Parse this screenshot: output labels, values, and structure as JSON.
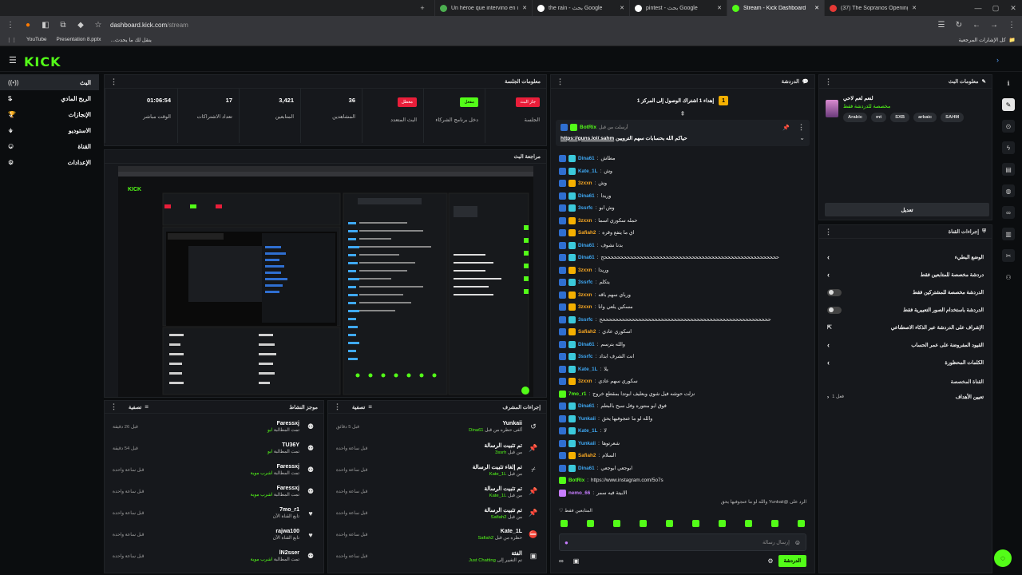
{
  "browser": {
    "tabs": [
      {
        "title": "(37) The Sopranos Opening Cre",
        "color": "#e53935",
        "active": false
      },
      {
        "title": "Stream - Kick Dashboard",
        "color": "#53fc18",
        "active": true
      },
      {
        "title": "pintest - بحث Google",
        "color": "#ffffff",
        "active": false
      },
      {
        "title": "the rain - بحث Google",
        "color": "#ffffff",
        "active": false
      },
      {
        "title": "Un héroe que intervino en un a",
        "color": "#4caf50",
        "active": false
      }
    ],
    "url_host": "dashboard.kick.com",
    "url_path": "/stream",
    "bookmarks": [
      "كل الإشارات المرجعية",
      "YouTube",
      "Presentation 8.pptx",
      "ينقل لك ما يحدث..."
    ]
  },
  "brand": {
    "logo": "KICK"
  },
  "sidebar": {
    "items": [
      {
        "label": "البث",
        "icon": "live-icon",
        "active": true
      },
      {
        "label": "الربح المادي",
        "icon": "dollar-icon",
        "active": false
      },
      {
        "label": "الإنجازات",
        "icon": "trophy-icon",
        "active": false
      },
      {
        "label": "الاستوديو",
        "icon": "studio-icon",
        "active": false
      },
      {
        "label": "القناة",
        "icon": "channel-icon",
        "active": false
      },
      {
        "label": "الإعدادات",
        "icon": "gear-icon",
        "active": false
      }
    ]
  },
  "session": {
    "title": "معلومات الجلسة",
    "stats": [
      {
        "value": "جار البث",
        "label": "الجلسة",
        "badge_color": "#e91e3a"
      },
      {
        "value": "مفعل",
        "label": "دخل برنامج الشركاء",
        "badge_color": "#53fc18"
      },
      {
        "value": "معطل",
        "label": "البث المتعدد",
        "badge_color": "#e91e3a"
      },
      {
        "value": "36",
        "label": "المشاهدين"
      },
      {
        "value": "3,421",
        "label": "المتابعين"
      },
      {
        "value": "17",
        "label": "تعداد الاشتراكات"
      },
      {
        "value": "01:06:54",
        "label": "الوقت مباشر"
      }
    ]
  },
  "preview": {
    "title": "مراجعة البث"
  },
  "activity": {
    "title": "موجز النشاط",
    "filter": "تصفية",
    "items": [
      {
        "name": "Faressxj",
        "sub": "تمت المطالبة",
        "reward": "ابو",
        "time": "قبل 26 دقيقة"
      },
      {
        "name": "TU36Y",
        "sub": "تمت المطالبة",
        "reward": "ابو",
        "time": "قبل 54 دقيقة"
      },
      {
        "name": "Faressxj",
        "sub": "تمت المطالبة",
        "reward": "اشرب موية",
        "time": "قبل ساعة واحدة"
      },
      {
        "name": "Faressxj",
        "sub": "تمت المطالبة",
        "reward": "اشرب موية",
        "time": "قبل ساعة واحدة"
      },
      {
        "name": "7mo_r1",
        "sub": "تابع القناة الآن",
        "reward": "",
        "time": "قبل ساعة واحدة"
      },
      {
        "name": "rajwa100",
        "sub": "تابع القناة الآن",
        "reward": "",
        "time": "قبل ساعة واحدة"
      },
      {
        "name": "lN2sser",
        "sub": "تمت المطالبة",
        "reward": "اشرب موية",
        "time": "قبل ساعة واحدة"
      }
    ]
  },
  "modactions": {
    "title": "إجراءات المشرف",
    "filter": "تصفية",
    "items": [
      {
        "name": "Yunkaii",
        "sub": "ألغى حظره من قبل",
        "by": "Dina61",
        "time": "قبل 5 دقائق"
      },
      {
        "name": "تم تثبيت الرسالة",
        "sub": "من قبل",
        "by": "3ssrh",
        "time": "قبل ساعة واحدة"
      },
      {
        "name": "تم إلغاء تثبيت الرسالة",
        "sub": "من قبل",
        "by": "Kate_1L",
        "time": "قبل ساعة واحدة"
      },
      {
        "name": "تم تثبيت الرسالة",
        "sub": "من قبل",
        "by": "Kate_1L",
        "time": "قبل ساعة واحدة"
      },
      {
        "name": "تم تثبيت الرسالة",
        "sub": "من قبل",
        "by": "Safiah2",
        "time": "قبل ساعة واحدة"
      },
      {
        "name": "Kate_1L",
        "sub": "حظره من قبل",
        "by": "Safiah2",
        "time": "قبل ساعة واحدة"
      },
      {
        "name": "الفئة",
        "sub": "تم التغيير إلى",
        "by": "Just Chatting",
        "time": "قبل ساعة واحدة"
      }
    ]
  },
  "chat": {
    "title": "الدردشة",
    "goal": "إهداء 1 اشتراك الوصول إلى المركز 1",
    "goal_rank": "1",
    "pinned_by": "أرسلت من قبل",
    "pinned_user": "BotRix",
    "pinned_text": "حياكم الله بحسابات سهم الترويين",
    "pinned_link": "https://guns.lol/.sahm",
    "messages": [
      {
        "user": "Dina61",
        "color": "#3fa9f5",
        "text": "مطاش"
      },
      {
        "user": "Kate_1L",
        "color": "#3fa9f5",
        "text": "وش"
      },
      {
        "user": "3zxxn",
        "color": "#f5a623",
        "text": "وش"
      },
      {
        "user": "Dina61",
        "color": "#3fa9f5",
        "text": "وريدا"
      },
      {
        "user": "3ssrfc",
        "color": "#3fa9f5",
        "text": "وش ابو"
      },
      {
        "user": "3zxxn",
        "color": "#f5a623",
        "text": "حمله سكوري اسما"
      },
      {
        "user": "Safiah2",
        "color": "#f5a623",
        "text": "اي ما يتفع وقره"
      },
      {
        "user": "Dina61",
        "color": "#3fa9f5",
        "text": "بدنا نشوف"
      },
      {
        "user": "Dina61",
        "color": "#3fa9f5",
        "text": "ححححححححححححححححححححححححححححححححححححححححححححححححححححححح"
      },
      {
        "user": "3zxxn",
        "color": "#f5a623",
        "text": "وريدا"
      },
      {
        "user": "3ssrfc",
        "color": "#3fa9f5",
        "text": "يتكلم"
      },
      {
        "user": "3zxxn",
        "color": "#f5a623",
        "text": "ورباي سهم باقه"
      },
      {
        "user": "3zxxn",
        "color": "#f5a623",
        "text": "مسكين يلعي وانا"
      },
      {
        "user": "3ssrfc",
        "color": "#3fa9f5",
        "text": "ححححححححححححححححححححححححححححححححححححححححححححححححححححح"
      },
      {
        "user": "Safiah2",
        "color": "#f5a623",
        "text": "اسكوري عادي"
      },
      {
        "user": "Dina61",
        "color": "#3fa9f5",
        "text": "والله بترسم"
      },
      {
        "user": "3ssrfc",
        "color": "#3fa9f5",
        "text": "انت الشرف ابداد"
      },
      {
        "user": "Kate_1L",
        "color": "#3fa9f5",
        "text": "يلا"
      },
      {
        "user": "3zxxn",
        "color": "#f5a623",
        "text": "سكوري سهم عادي"
      },
      {
        "user": "7mo_r1",
        "color": "#53fc18",
        "text": "نزلت حوشه فيل شوي وبعليف ابوتدا بمقطع خروج"
      },
      {
        "user": "Dina61",
        "color": "#3fa9f5",
        "text": "فوق ابو منتوره وفل سيح بالبطم"
      },
      {
        "user": "Yunkaii",
        "color": "#3fa9f5",
        "text": "والله لو ما عنجوفيها يحق"
      },
      {
        "user": "Kate_1L",
        "color": "#3fa9f5",
        "text": "لا"
      },
      {
        "user": "Yunkaii",
        "color": "#3fa9f5",
        "text": "شعرتوها"
      },
      {
        "user": "Safiah2",
        "color": "#f5a623",
        "text": "السلام"
      },
      {
        "user": "Dina61",
        "color": "#3fa9f5",
        "text": "ابوجعي ابوجعي"
      },
      {
        "user": "BotRix",
        "color": "#53fc18",
        "text": "https://www.instagram.com/5o7s"
      },
      {
        "user": "nemo_66",
        "color": "#c77dff",
        "text": "الابيتة فيه سمر"
      }
    ],
    "reply_hint": "الرد على @Yunkaii والله لو ما عنجوفيها يحق",
    "followers_only": "المتابعين فقط",
    "input_placeholder": "إرسال رسالة",
    "send_label": "الدردشة"
  },
  "channel": {
    "title": "معلومات البث",
    "stream_title": "لنعم لعم لاحي",
    "category": "مخصصة للدردشة فقط",
    "tags": [
      "Arabic",
      "mt",
      "SXB",
      "arbaic",
      "SAHM"
    ],
    "edit_label": "تعديل"
  },
  "actions": {
    "title": "إجراءات القناة",
    "rows": [
      {
        "label": "الوضع البطيء",
        "type": "chevron"
      },
      {
        "label": "دردشة مخصصة للمتابعين فقط",
        "type": "chevron"
      },
      {
        "label": "الدردشة مخصصة للمشتركين فقط",
        "type": "toggle"
      },
      {
        "label": "الدردشة باستخدام الصور التعبيرية فقط",
        "type": "toggle"
      },
      {
        "label": "الإشراف على الدردشة عبر الذكاء الاصطناعي",
        "type": "external"
      },
      {
        "label": "القيود المفروضة على عمر الحساب",
        "type": "chevron"
      },
      {
        "label": "الكلمات المحظورة",
        "type": "chevron"
      }
    ],
    "section_label": "القناة المخصصة",
    "goals_label": "تعيين الأهداف",
    "goals_value": "فعل 1"
  }
}
